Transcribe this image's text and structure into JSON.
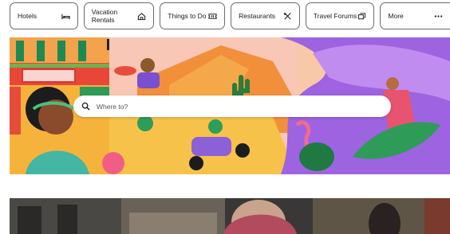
{
  "nav": {
    "tabs": [
      {
        "label": "Hotels",
        "icon": "bed-icon"
      },
      {
        "label": "Vacation Rentals",
        "icon": "house-icon"
      },
      {
        "label": "Things to Do",
        "icon": "ticket-icon"
      },
      {
        "label": "Restaurants",
        "icon": "utensils-icon"
      },
      {
        "label": "Travel Forums",
        "icon": "chat-icon"
      },
      {
        "label": "More",
        "icon": "more-dots-icon"
      }
    ]
  },
  "hero": {
    "search": {
      "placeholder": "Where to?",
      "value": ""
    }
  },
  "colors": {
    "tab_border": "#6b6b6b",
    "hero_orange": "#f6a72b",
    "hero_purple": "#8d5bd6",
    "hero_pink": "#f27a9e",
    "hero_green": "#1f8a4c"
  }
}
